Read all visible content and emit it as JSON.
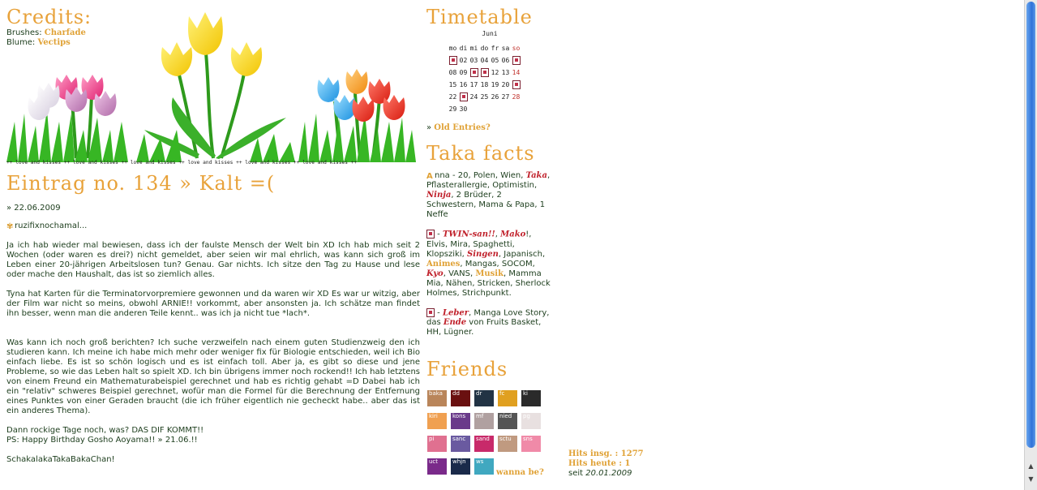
{
  "credits": {
    "title": "Credits:",
    "brushes_label": "Brushes:",
    "brushes_link": "Charfade",
    "blume_label": "Blume:",
    "blume_link": "Vectips"
  },
  "banner": {
    "caption": "++ love and kisses ++ love and kisses ++ love and kisses ++ love and kisses ++ love and kisses ++ love and kisses ++"
  },
  "entry": {
    "title": "Eintrag no. 134 » Kalt =(",
    "date": "» 22.06.2009",
    "greeting": "ruzifixnochamal...",
    "p1": "Ja ich hab wieder mal bewiesen, dass ich der faulste Mensch der Welt bin XD Ich hab mich seit 2 Wochen (oder waren es drei?) nicht gemeldet, aber seien wir mal ehrlich, was kann sich groß im Leben einer 20-jährigen Arbeitslosen tun? Genau. Gar nichts. Ich sitze den Tag zu Hause und lese oder mache den Haushalt, das ist so ziemlich alles.",
    "p2": "Tyna hat Karten für die Terminatorvorpremiere gewonnen und da waren wir XD Es war ur witzig, aber der Film war nicht so meins, obwohl ARNIE!! vorkommt, aber ansonsten ja. Ich schätze man findet ihn besser, wenn man die anderen Teile kennt.. was ich ja nicht tue *lach*.",
    "p3": "Was kann ich noch groß berichten? Ich suche verzweifeln nach einem guten Studienzweig den ich studieren kann. Ich meine ich habe mich mehr oder weniger fix für Biologie entschieden, weil ich Bio einfach liebe. Es ist so schön logisch und es ist einfach toll. Aber ja, es gibt so diese und jene Probleme, so wie das Leben halt so spielt XD. Ich bin übrigens immer noch rockend!! Ich hab letztens von einem Freund ein Mathematurabeispiel gerechnet und hab es richtig gehabt =D Dabei hab ich ein \"relativ\" schweres Beispiel gerechnet, wofür man die Formel für die Berechnung der Entfernung eines Punktes von einer Geraden braucht (die ich früher eigentlich nie gecheckt habe.. aber das ist ein anderes Thema).",
    "p4a": "Dann rockige Tage noch, was? DAS DIF KOMMT!!",
    "p4b": "PS: Happy Birthday Gosho Aoyama!! » 21.06.!!",
    "signature": "SchakalakaTakaBakaChan!"
  },
  "timetable": {
    "title": "Timetable",
    "month": "Juni",
    "weekdays": [
      "mo",
      "di",
      "mi",
      "do",
      "fr",
      "sa",
      "so"
    ],
    "weeks": [
      [
        "*",
        "02",
        "03",
        "04",
        "05",
        "06",
        "*"
      ],
      [
        "08",
        "09",
        "*",
        "*",
        "12",
        "13",
        "14"
      ],
      [
        "15",
        "16",
        "17",
        "18",
        "19",
        "20",
        "*"
      ],
      [
        "22",
        "*",
        "24",
        "25",
        "26",
        "27",
        "28"
      ],
      [
        "29",
        "30",
        "",
        "",
        "",
        "",
        ""
      ]
    ],
    "old_entries": "Old Entries?"
  },
  "facts": {
    "title": "Taka facts",
    "block1": {
      "a": "nna - 20, Polen, Wien,",
      "taka": "Taka",
      "b": ", Pflasterallergie, Optimistin,",
      "ninja": "Ninja",
      "c": ", 2 Brüder, 2 Schwestern, Mama & Papa, 1 Neffe"
    },
    "block2": {
      "dash": " - ",
      "twin": "TWIN-san!!",
      "sep1": ", ",
      "mako": "Mako",
      "a": "!, Elvis, Mira, Spaghetti, Klopsziki, ",
      "singen": "Singen",
      "b": ", Japanisch, ",
      "animes": "Animes",
      "c": ", Mangas, SOCOM, ",
      "kyo": "Kyo",
      "d": ", VANS, ",
      "musik": "Musik",
      "e": ", Mamma Mia, Nähen, Stricken, Sherlock Holmes, Strichpunkt."
    },
    "block3": {
      "dash": " - ",
      "leber": "Leber",
      "a": ", Manga Love Story, das ",
      "ende": "Ende",
      "b": " von Fruits Basket, HH, Lügner."
    }
  },
  "friends": {
    "title": "Friends",
    "avatars": [
      {
        "label": "baka",
        "color": "#b9855a"
      },
      {
        "label": "dd",
        "color": "#6a1010"
      },
      {
        "label": "dr",
        "color": "#223344"
      },
      {
        "label": "fc",
        "color": "#e0a020"
      },
      {
        "label": "ki",
        "color": "#2a2a2a"
      },
      {
        "label": "kiri",
        "color": "#f0a050"
      },
      {
        "label": "kons",
        "color": "#6a3a8a"
      },
      {
        "label": "mf",
        "color": "#b0a0a0"
      },
      {
        "label": "nied",
        "color": "#555555"
      },
      {
        "label": "pg",
        "color": "#e8e0e0"
      },
      {
        "label": "pi",
        "color": "#e07090"
      },
      {
        "label": "sanc",
        "color": "#6a5aa0"
      },
      {
        "label": "sand",
        "color": "#c82a6a"
      },
      {
        "label": "sctu",
        "color": "#c09a80"
      },
      {
        "label": "sns",
        "color": "#f08aa8"
      },
      {
        "label": "uct",
        "color": "#7a2a8a"
      },
      {
        "label": "whjn",
        "color": "#1a2a4a"
      },
      {
        "label": "ws",
        "color": "#40a8c0"
      }
    ],
    "wanna_be": "wanna be?"
  },
  "hits": {
    "total_label": "Hits insg. : 1277",
    "today_label": "Hits heute : 1",
    "since_label": "seit",
    "since_date": "20.01.2009"
  },
  "colors": {
    "accent": "#e8a23a",
    "text": "#1c3d1c",
    "highlight": "#c0202a"
  }
}
